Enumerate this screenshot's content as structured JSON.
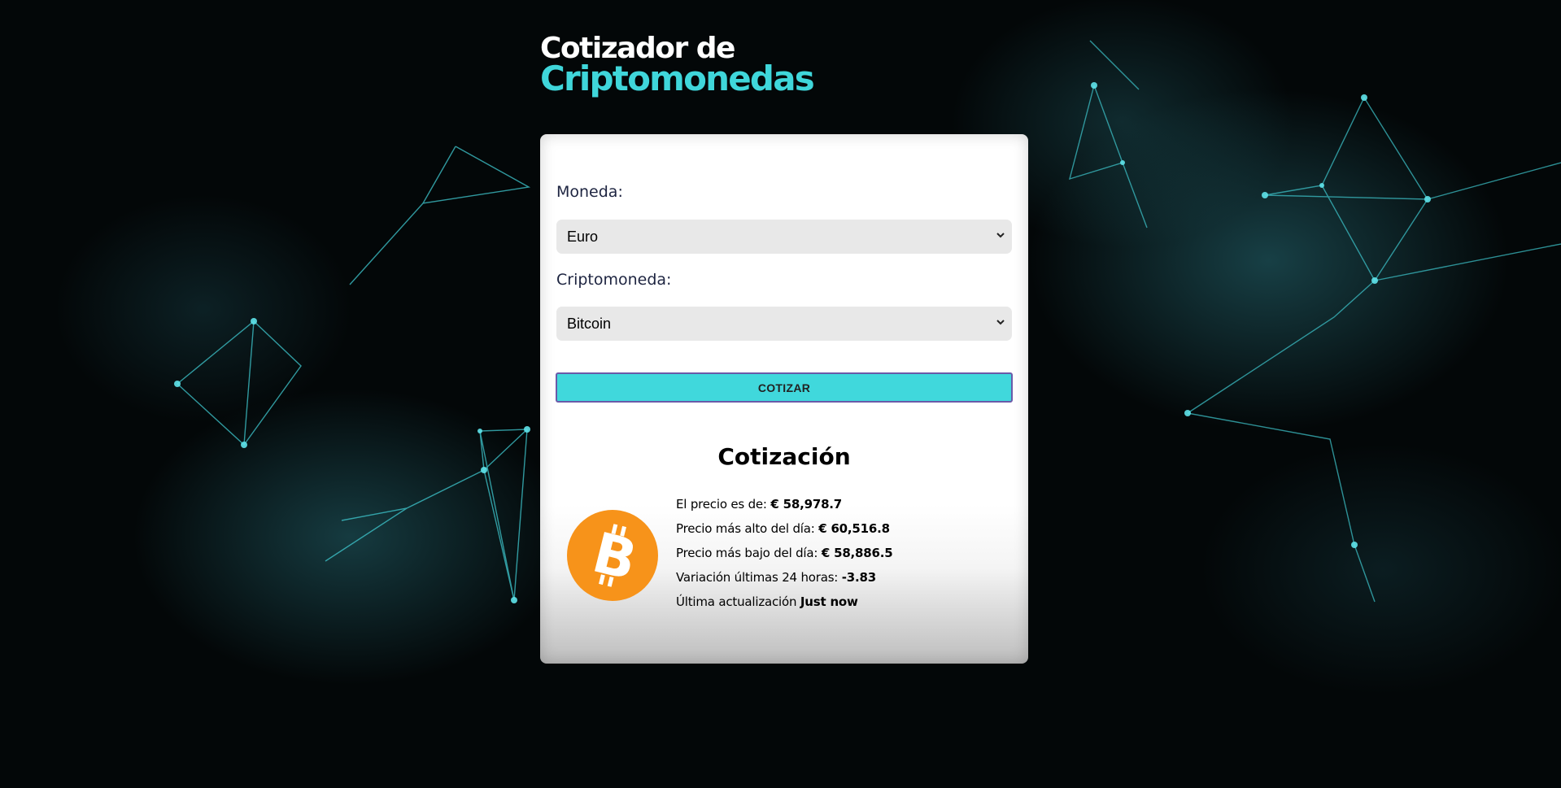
{
  "header": {
    "title_line1": "Cotizador de",
    "title_line2": "Criptomonedas"
  },
  "form": {
    "currency_label": "Moneda:",
    "currency_selected": "Euro",
    "crypto_label": "Criptomoneda:",
    "crypto_selected": "Bitcoin",
    "submit_label": "COTIZAR"
  },
  "result": {
    "title": "Cotización",
    "coin_icon": "bitcoin-icon",
    "rows": [
      {
        "label": "El precio es de:",
        "value": "€ 58,978.7"
      },
      {
        "label": "Precio más alto del día:",
        "value": "€ 60,516.8"
      },
      {
        "label": "Precio más bajo del día:",
        "value": "€ 58,886.5"
      },
      {
        "label": "Variación últimas 24 horas:",
        "value": "-3.83"
      },
      {
        "label": "Última actualización",
        "value": "Just now"
      }
    ]
  },
  "colors": {
    "accent": "#40d8dc",
    "title_accent": "#3fd6da",
    "bitcoin_orange": "#f7931a",
    "background": "#030708"
  }
}
